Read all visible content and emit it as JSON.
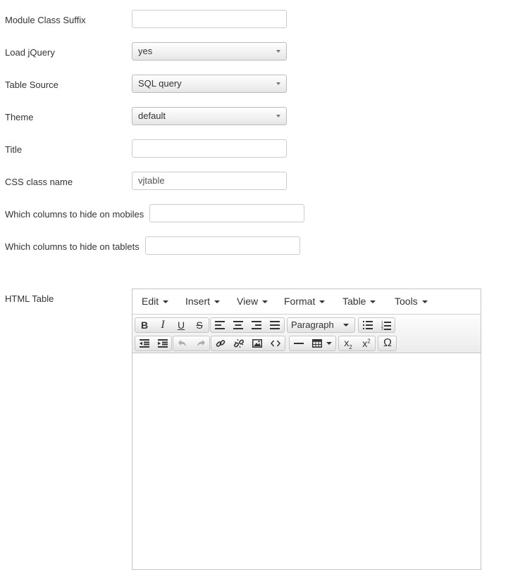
{
  "form": {
    "module_class_suffix": {
      "label": "Module Class Suffix",
      "value": ""
    },
    "load_jquery": {
      "label": "Load jQuery",
      "value": "yes"
    },
    "table_source": {
      "label": "Table Source",
      "value": "SQL query"
    },
    "theme": {
      "label": "Theme",
      "value": "default"
    },
    "title": {
      "label": "Title",
      "value": ""
    },
    "css_class_name": {
      "label": "CSS class name",
      "value": "vjtable"
    },
    "hide_mobiles": {
      "label": "Which columns to hide on mobiles",
      "value": ""
    },
    "hide_tablets": {
      "label": "Which columns to hide on tablets",
      "value": ""
    }
  },
  "html_table": {
    "label": "HTML Table",
    "menu": [
      "Edit",
      "Insert",
      "View",
      "Format",
      "Table",
      "Tools"
    ],
    "format_select": "Paragraph",
    "toolbar_icons": {
      "row1": [
        "bold-icon",
        "italic-icon",
        "underline-icon",
        "strikethrough-icon",
        "align-left-icon",
        "align-center-icon",
        "align-right-icon",
        "align-justify-icon",
        "bullet-list-icon",
        "numbered-list-icon"
      ],
      "row2": [
        "outdent-icon",
        "indent-icon",
        "undo-icon",
        "redo-icon",
        "link-icon",
        "unlink-icon",
        "image-icon",
        "code-icon",
        "horizontal-rule-icon",
        "table-icon",
        "subscript-icon",
        "superscript-icon",
        "omega-icon"
      ]
    },
    "content": ""
  }
}
